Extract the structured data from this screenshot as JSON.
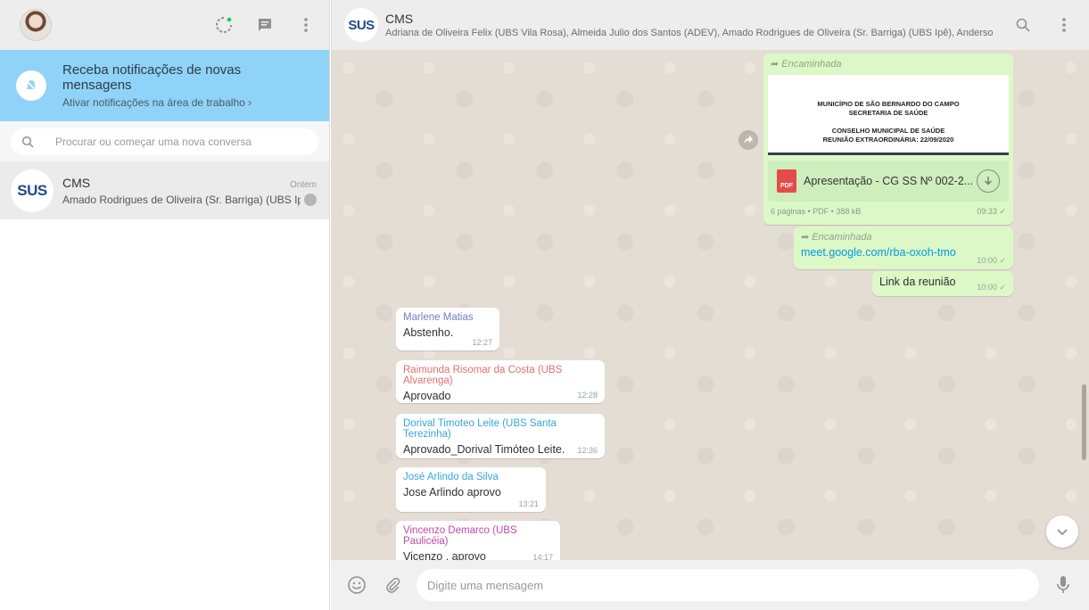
{
  "left": {
    "notification": {
      "title": "Receba notificações de novas mensagens",
      "subtitle": "Ativar notificações na área de trabalho ›"
    },
    "search": {
      "placeholder": "Procurar ou começar uma nova conversa"
    },
    "chats": [
      {
        "avatar_text": "SUS",
        "name": "CMS",
        "time": "Ontem",
        "last_message": "Amado Rodrigues de Oliveira (Sr. Barriga) (UBS Ipê"
      }
    ]
  },
  "conversation": {
    "avatar_text": "SUS",
    "title": "CMS",
    "members": "Adriana de Oliveira Felix (UBS Vila Rosa), Almeida Julio dos Santos (ADEV), Amado Rodrigues de Oliveira (Sr. Barriga) (UBS Ipê), Anderson Fr..."
  },
  "messages": {
    "document": {
      "forwarded_label": "Encaminhada",
      "preview_lines": [
        "MUNICÍPIO DE SÃO BERNARDO DO CAMPO",
        "SECRETARIA DE SAÚDE",
        "CONSELHO MUNICIPAL DE SAÚDE",
        "REUNIÃO EXTRAORDINÁRIA: 22/09/2020"
      ],
      "file_type_label": "PDF",
      "file_name": "Apresentação - CG SS Nº 002-2...",
      "meta": "6 páginas • PDF • 388 kB",
      "time": "09:33 ✓"
    },
    "link_msg": {
      "forwarded_label": "Encaminhada",
      "url": "meet.google.com/rba-oxoh-tmo",
      "time": "10:00 ✓"
    },
    "link_caption": {
      "text": "Link da reunião",
      "time": "10:00 ✓"
    },
    "incoming": [
      {
        "sender": "Marlene Matias",
        "sender_color": "#6f7fc0",
        "text": "Abstenho.",
        "time": "12:27"
      },
      {
        "sender": "Raimunda Risomar da Costa (UBS Alvarenga)",
        "sender_color": "#e07070",
        "text": "Aprovado",
        "time": "12:28"
      },
      {
        "sender": "Dorival Timoteo Leite (UBS Santa Terezinha)",
        "sender_color": "#35a8d8",
        "text": "Aprovado_Dorival Timóteo Leite.",
        "time": "12:36"
      },
      {
        "sender": "José Arlindo da Silva",
        "sender_color": "#35a8d8",
        "text": "Jose Arlindo aprovo",
        "time": "13:21"
      },
      {
        "sender": "Vincenzo Demarco (UBS Paulicéia)",
        "sender_color": "#c04aa8",
        "text": "Vicenzo . aprovo",
        "time": "14:17"
      }
    ]
  },
  "composer": {
    "placeholder": "Digite uma mensagem"
  },
  "colors": {
    "header_bg": "#ededed",
    "notif_bg": "#8fd3f8",
    "outgoing_bubble": "#dcf8c6",
    "chat_bg": "#e3ddd4"
  },
  "icons": [
    "status-icon",
    "new-chat-icon",
    "menu-icon",
    "bell-off-icon",
    "search-icon",
    "forward-icon",
    "pdf-icon",
    "download-icon",
    "share-icon",
    "chevron-down-icon",
    "emoji-icon",
    "attach-icon",
    "mic-icon"
  ]
}
